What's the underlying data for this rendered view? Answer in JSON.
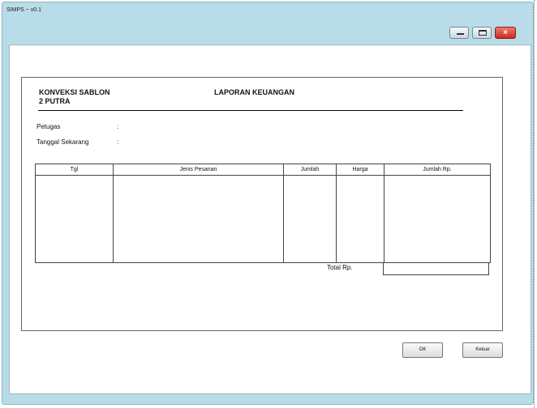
{
  "window": {
    "title": "SIMPS ~ v0.1"
  },
  "controls": {
    "minimize": "—",
    "maximize": "□",
    "close": "×"
  },
  "report": {
    "company_line1": "KONVEKSI SABLON",
    "company_line2": "2 PUTRA",
    "heading": "LAPORAN KEUANGAN",
    "petugas_label": "Petugas",
    "petugas_colon": ":",
    "tanggal_label": "Tanggal Sekarang",
    "tanggal_colon": ":"
  },
  "table": {
    "columns": [
      "Tgl",
      "Jenis Pesanan",
      "Jumlah",
      "Harga",
      "Jumlah Rp."
    ]
  },
  "total": {
    "label": "Total Rp."
  },
  "buttons": {
    "ok": "OK",
    "keluar": "Keluar"
  }
}
